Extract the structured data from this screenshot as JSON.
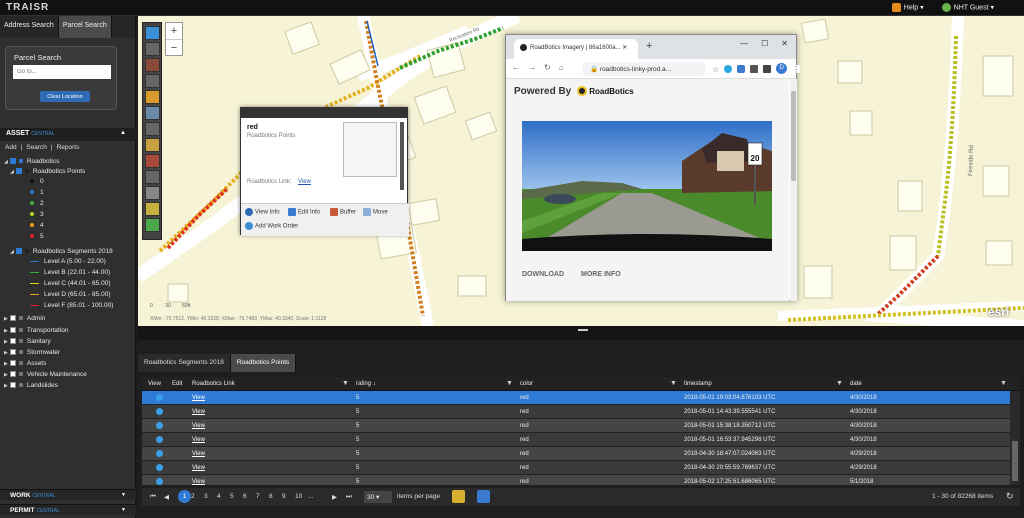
{
  "app": {
    "logo": "TRAISR"
  },
  "topbar": {
    "help": "Help",
    "user": "NHT Guest",
    "help_arrow": "▾",
    "user_arrow": "▾"
  },
  "sidebar": {
    "tabs": [
      "Address Search",
      "Parcel Search"
    ],
    "parcel_search": {
      "title": "Parcel Search",
      "placeholder": "Go to...",
      "button": "Clear Location"
    },
    "asset_header": {
      "title": "ASSET",
      "suffix": "CENTRAL"
    },
    "asset_links": [
      "Add",
      "|",
      "Search",
      "|",
      "Reports"
    ],
    "tree": [
      {
        "label": "Roadbotics",
        "level": 0
      },
      {
        "label": "Roadbotics Points",
        "level": 1
      },
      {
        "label": "0",
        "level": 2,
        "color": "#111111"
      },
      {
        "label": "1",
        "level": 2,
        "color": "#2e7bd6"
      },
      {
        "label": "2",
        "level": 2,
        "color": "#3cae3c"
      },
      {
        "label": "3",
        "level": 2,
        "color": "#b8d020"
      },
      {
        "label": "4",
        "level": 2,
        "color": "#f0a020"
      },
      {
        "label": "5",
        "level": 2,
        "color": "#e02020"
      },
      {
        "label": "Roadbotics Segments 2018",
        "level": 1
      },
      {
        "label": "Level A (5.00 - 22.00)",
        "level": 2,
        "color": "#2e7bd6"
      },
      {
        "label": "Level B (22.01 - 44.00)",
        "level": 2,
        "color": "#3cae3c"
      },
      {
        "label": "Level C (44.01 - 65.00)",
        "level": 2,
        "color": "#d8d820"
      },
      {
        "label": "Level D (65.01 - 85.00)",
        "level": 2,
        "color": "#f0a020"
      },
      {
        "label": "Level F (85.01 - 100.00)",
        "level": 2,
        "color": "#e02020"
      },
      {
        "label": "Admin",
        "level": 0
      },
      {
        "label": "Transportation",
        "level": 0
      },
      {
        "label": "Sanitary",
        "level": 0
      },
      {
        "label": "Stormwater",
        "level": 0
      },
      {
        "label": "Assets",
        "level": 0
      },
      {
        "label": "Vehicle Maintenance",
        "level": 0
      },
      {
        "label": "Landslides",
        "level": 0
      }
    ],
    "work": {
      "title": "WORK",
      "suffix": "CENTRAL"
    },
    "permit": {
      "title": "PERMIT",
      "suffix": "CENTRAL"
    }
  },
  "map": {
    "zoom_in": "+",
    "zoom_out": "−",
    "scale_labels": [
      "0",
      "30",
      "60ft"
    ],
    "coords": "XMin: -79.7512, YMin: 40.3328, XMax: -79.7483, YMax: 40.3340, Scale: 1:1128",
    "esri": "esri",
    "street": "Fireside Rd"
  },
  "popup": {
    "title": "red",
    "subtitle": "Roadbotics Points",
    "link_label": "Roadbotics Link:",
    "link_value": "View",
    "actions": [
      "View Info",
      "Edit Info",
      "Buffer",
      "Move",
      "Add Work Order"
    ]
  },
  "browser": {
    "tab_title": "RoadBotics Imagery | 86a1600a...",
    "url": "roadbotics-linky-prod.a...",
    "powered_by": "Powered By",
    "brand": "RoadBotics",
    "buttons": [
      "DOWNLOAD",
      "MORE INFO"
    ],
    "avatar": "D",
    "speed_sign": "20"
  },
  "table": {
    "tabs": [
      "Roadbotics Segments 2018",
      "Roadbotics Points"
    ],
    "columns": [
      "View",
      "Edit",
      "Roadbotics Link",
      "rating",
      "color",
      "timestamp",
      "date"
    ],
    "rows": [
      {
        "link": "View",
        "rating": "5",
        "color": "red",
        "timestamp": "2018-05-01 19:03:04.676103 UTC",
        "date": "4/30/2018"
      },
      {
        "link": "View",
        "rating": "5",
        "color": "red",
        "timestamp": "2018-05-01 14:43:39.555541 UTC",
        "date": "4/30/2018"
      },
      {
        "link": "View",
        "rating": "5",
        "color": "red",
        "timestamp": "2018-05-01 15:38:18.350712 UTC",
        "date": "4/30/2018"
      },
      {
        "link": "View",
        "rating": "5",
        "color": "red",
        "timestamp": "2018-05-01 16:53:37.945298 UTC",
        "date": "4/30/2018"
      },
      {
        "link": "View",
        "rating": "5",
        "color": "red",
        "timestamp": "2018-04-30 18:47:07.024063 UTC",
        "date": "4/29/2018"
      },
      {
        "link": "View",
        "rating": "5",
        "color": "red",
        "timestamp": "2018-04-30 20:55:59.769637 UTC",
        "date": "4/29/2018"
      },
      {
        "link": "View",
        "rating": "5",
        "color": "red",
        "timestamp": "2018-05-02 17:25:51.686065 UTC",
        "date": "5/1/2018"
      }
    ],
    "pager": {
      "first": "⏮",
      "prev": "◀",
      "pages": [
        "1",
        "2",
        "3",
        "4",
        "5",
        "6",
        "7",
        "8",
        "9",
        "10",
        "..."
      ],
      "next": "▶",
      "last": "⏭",
      "per_page": "30",
      "per_page_label": "items per page",
      "summary": "1 - 30 of 82268 items",
      "refresh": "↻"
    }
  },
  "colors": {
    "accent": "#2f7ad4",
    "selected_row": "#2f7ad4"
  }
}
